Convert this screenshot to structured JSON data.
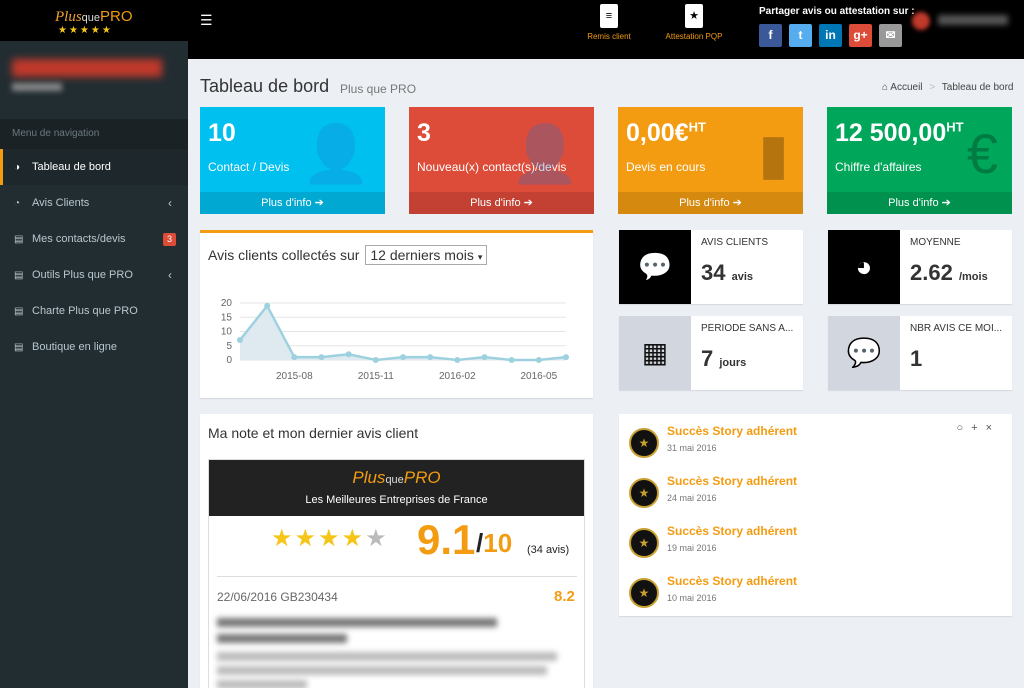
{
  "brand": {
    "logo_plus": "Plus",
    "logo_que": "que",
    "logo_pro": "PRO",
    "stars": "★★★★★"
  },
  "topbar": {
    "menu_icon": "☰",
    "remis_client": "Remis client",
    "attestation": "Attestation PQP",
    "share_label": "Partager avis ou attestation sur :",
    "social": [
      {
        "name": "facebook",
        "glyph": "f",
        "color": "#3b5998"
      },
      {
        "name": "twitter",
        "glyph": "t",
        "color": "#55acee"
      },
      {
        "name": "linkedin",
        "glyph": "in",
        "color": "#0077b5"
      },
      {
        "name": "google-plus",
        "glyph": "g+",
        "color": "#dd4b39"
      },
      {
        "name": "email",
        "glyph": "✉",
        "color": "#999999"
      }
    ]
  },
  "sidebar": {
    "header": "Menu de navigation",
    "items": [
      {
        "label": "Tableau de bord",
        "icon": "dashboard-icon",
        "glyph": "◑"
      },
      {
        "label": "Avis Clients",
        "icon": "pie-chart-icon",
        "glyph": "◔",
        "chevron": "‹"
      },
      {
        "label": "Mes contacts/devis",
        "icon": "file-icon",
        "glyph": "▤",
        "badge": "3"
      },
      {
        "label": "Outils Plus que PRO",
        "icon": "file-icon",
        "glyph": "▤",
        "chevron": "‹"
      },
      {
        "label": "Charte Plus que PRO",
        "icon": "file-icon",
        "glyph": "▤"
      },
      {
        "label": "Boutique en ligne",
        "icon": "file-icon",
        "glyph": "▤"
      }
    ]
  },
  "page": {
    "title": "Tableau de bord",
    "subtitle": "Plus que PRO"
  },
  "breadcrumb": {
    "home_icon": "⌂",
    "home": "Accueil",
    "sep": ">",
    "current": "Tableau de bord"
  },
  "stat_boxes": [
    {
      "value": "10",
      "sup": "",
      "label": "Contact / Devis",
      "footer": "Plus d'info ➔",
      "color": "#00c0ef",
      "icon": "user-icon",
      "glyph": "👤"
    },
    {
      "value": "3",
      "sup": "",
      "label": "Nouveau(x) contact(s)/devis",
      "footer": "Plus d'info ➔",
      "color": "#dd4b39",
      "icon": "user-plus-icon",
      "glyph": "👤"
    },
    {
      "value": "0,00€",
      "sup": "HT",
      "label": "Devis en cours",
      "footer": "Plus d'info ➔",
      "color": "#f39c12",
      "icon": "file-icon",
      "glyph": "▮"
    },
    {
      "value": "12 500,00",
      "sup": "HT",
      "label": "Chiffre d'affaires",
      "footer": "Plus d'info ➔",
      "color": "#00a65a",
      "icon": "euro-icon",
      "glyph": "€"
    }
  ],
  "chart_panel": {
    "title": "Avis clients collectés sur",
    "select_value": "12 derniers mois",
    "caret": "▾"
  },
  "chart_data": {
    "type": "area",
    "x": [
      "2015-06",
      "2015-07",
      "2015-08",
      "2015-09",
      "2015-10",
      "2015-11",
      "2015-12",
      "2016-01",
      "2016-02",
      "2016-03",
      "2016-04",
      "2016-05",
      "2016-06"
    ],
    "values": [
      7,
      19,
      1,
      1,
      2,
      0,
      1,
      1,
      0,
      1,
      0,
      0,
      1
    ],
    "yticks": [
      "20",
      "15",
      "10",
      "5",
      "0"
    ],
    "xticks": [
      "2015-08",
      "2015-11",
      "2016-02",
      "2016-05"
    ],
    "ylim": [
      0,
      20
    ],
    "line_color": "#9dd1e0",
    "fill_color": "#dfeaf0"
  },
  "info_boxes": [
    {
      "title": "AVIS CLIENTS",
      "value": "34",
      "unit": "avis",
      "color": "#000000",
      "icon": "comments-icon",
      "glyph": "💬"
    },
    {
      "title": "MOYENNE",
      "value": "2.62",
      "unit": "/mois",
      "color": "#000000",
      "icon": "tachometer-icon",
      "glyph": "◕"
    },
    {
      "title": "PÉRIODE SANS A...",
      "value": "7",
      "unit": "jours",
      "color": "#d2d6de",
      "icon": "calendar-icon",
      "glyph": "▦"
    },
    {
      "title": "NBR AVIS CE MOI...",
      "value": "1",
      "unit": "",
      "color": "#d2d6de",
      "icon": "comment-icon",
      "glyph": "💬"
    }
  ],
  "note_panel": {
    "title": "Ma note et mon dernier avis client",
    "logo_plus": "Plus",
    "logo_que": "que",
    "logo_pro": "PRO",
    "tagline": "Les Meilleures Entreprises de France",
    "stars": "★★★★",
    "half_star": "★",
    "score": "9.1",
    "slash": "/",
    "out_of": "10",
    "count": "(34 avis)",
    "review_date": "22/06/2016 GB230434",
    "review_score": "8.2"
  },
  "stories": {
    "tools": [
      "○",
      "+",
      "×"
    ],
    "items": [
      {
        "title": "Succès Story adhérent",
        "date": "31 mai 2016"
      },
      {
        "title": "Succès Story adhérent",
        "date": "24 mai 2016"
      },
      {
        "title": "Succès Story adhérent",
        "date": "19 mai 2016"
      },
      {
        "title": "Succès Story adhérent",
        "date": "10 mai 2016"
      }
    ],
    "medal_glyph": "★"
  }
}
